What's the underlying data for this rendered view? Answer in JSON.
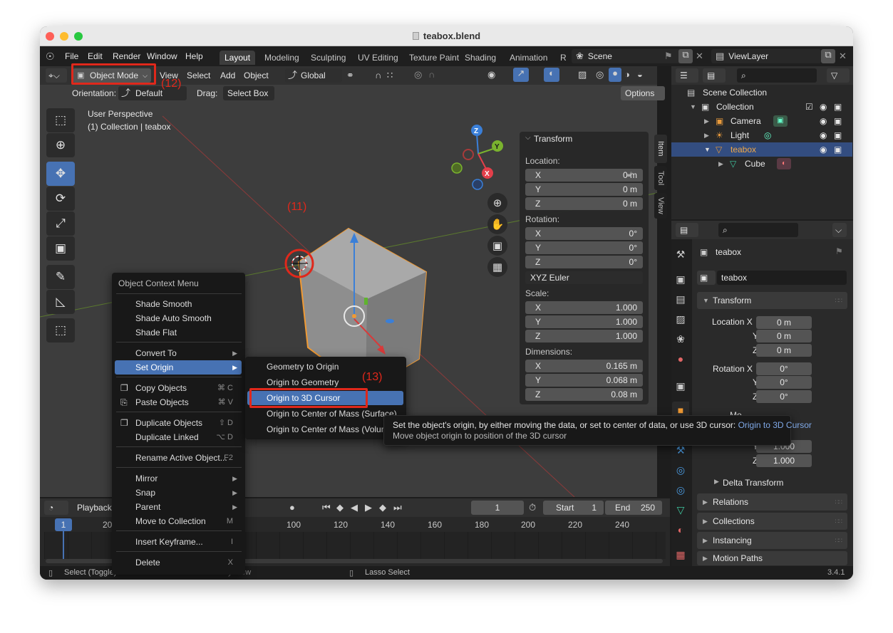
{
  "window": {
    "title": "teabox.blend",
    "traffic_colors": [
      "#fe5f57",
      "#febc2e",
      "#28c840"
    ]
  },
  "menu": {
    "file": "File",
    "edit": "Edit",
    "render": "Render",
    "window": "Window",
    "help": "Help"
  },
  "workspaces": [
    "Layout",
    "Modeling",
    "Sculpting",
    "UV Editing",
    "Texture Paint",
    "Shading",
    "Animation",
    "R"
  ],
  "scene": {
    "name": "Scene",
    "viewlayer": "ViewLayer"
  },
  "viewport_header": {
    "mode": "Object Mode",
    "view": "View",
    "select": "Select",
    "add": "Add",
    "object": "Object",
    "transform_orientation": "Global",
    "orientation_label": "Orientation:",
    "orientation_value": "Default",
    "drag_label": "Drag:",
    "drag_value": "Select Box",
    "options": "Options"
  },
  "viewport": {
    "perspective": "User Perspective",
    "collection_info": "(1) Collection | teabox"
  },
  "n_panel": {
    "tabs": [
      "Item",
      "Tool",
      "View"
    ],
    "transform": "Transform",
    "location_label": "Location:",
    "location": [
      {
        "axis": "X",
        "value": "0 m"
      },
      {
        "axis": "Y",
        "value": "0 m"
      },
      {
        "axis": "Z",
        "value": "0 m"
      }
    ],
    "rotation_label": "Rotation:",
    "rotation": [
      {
        "axis": "X",
        "value": "0°"
      },
      {
        "axis": "Y",
        "value": "0°"
      },
      {
        "axis": "Z",
        "value": "0°"
      }
    ],
    "rotation_mode": "XYZ Euler",
    "scale_label": "Scale:",
    "scale": [
      {
        "axis": "X",
        "value": "1.000"
      },
      {
        "axis": "Y",
        "value": "1.000"
      },
      {
        "axis": "Z",
        "value": "1.000"
      }
    ],
    "dimensions_label": "Dimensions:",
    "dimensions": [
      {
        "axis": "X",
        "value": "0.165 m"
      },
      {
        "axis": "Y",
        "value": "0.068 m"
      },
      {
        "axis": "Z",
        "value": "0.08 m"
      }
    ]
  },
  "context_menu": {
    "title": "Object Context Menu",
    "shade_smooth": "Shade Smooth",
    "shade_auto_smooth": "Shade Auto Smooth",
    "shade_flat": "Shade Flat",
    "convert_to": "Convert To",
    "set_origin": "Set Origin",
    "copy_objects": "Copy Objects",
    "copy_sc": "⌘ C",
    "paste_objects": "Paste Objects",
    "paste_sc": "⌘ V",
    "duplicate_objects": "Duplicate Objects",
    "duplicate_sc": "⇧ D",
    "duplicate_linked": "Duplicate Linked",
    "linked_sc": "⌥ D",
    "rename": "Rename Active Object...",
    "rename_sc": "F2",
    "mirror": "Mirror",
    "snap": "Snap",
    "parent": "Parent",
    "move_to_collection": "Move to Collection",
    "move_sc": "M",
    "insert_keyframe": "Insert Keyframe...",
    "keyframe_sc": "I",
    "delete": "Delete",
    "delete_sc": "X"
  },
  "submenu": [
    "Geometry to Origin",
    "Origin to Geometry",
    "Origin to 3D Cursor",
    "Origin to Center of Mass (Surface)",
    "Origin to Center of Mass (Volume)"
  ],
  "tooltip": {
    "desc": "Set the object's origin, by either moving the data, or set to center of data, or use 3D cursor:",
    "op": "Origin to 3D Cursor",
    "detail": "Move object origin to position of the 3D cursor"
  },
  "annotations": {
    "a11": "(11)",
    "a12": "(12)",
    "a13": "(13)"
  },
  "outliner": {
    "scene_collection": "Scene Collection",
    "rows": [
      {
        "name": "Collection"
      },
      {
        "name": "Camera"
      },
      {
        "name": "Light"
      },
      {
        "name": "teabox"
      },
      {
        "name": "Cube"
      }
    ]
  },
  "properties": {
    "object_name": "teabox",
    "data_name": "teabox",
    "transform": "Transform",
    "location_x_label": "Location X",
    "location": [
      "0 m",
      "0 m",
      "0 m"
    ],
    "rotation_x_label": "Rotation X",
    "rotation": [
      "0°",
      "0°",
      "0°"
    ],
    "y_label": "Y",
    "z_label": "Z",
    "mode_label_partial": "Mo",
    "scale": [
      "1.000",
      "1.000"
    ],
    "delta_transform": "Delta Transform",
    "sections": [
      "Relations",
      "Collections",
      "Instancing",
      "Motion Paths"
    ]
  },
  "timeline": {
    "playback": "Playback",
    "current_frame": "1",
    "start_label": "Start",
    "start_value": "1",
    "end_label": "End",
    "end_value": "250",
    "frame_marker": "1",
    "ticks": [
      "20",
      "100",
      "120",
      "140",
      "160",
      "180",
      "200",
      "220",
      "240"
    ]
  },
  "status": {
    "select": "Select (Toggle)",
    "dolly": "Dolly View",
    "lasso": "Lasso Select",
    "version": "3.4.1"
  }
}
